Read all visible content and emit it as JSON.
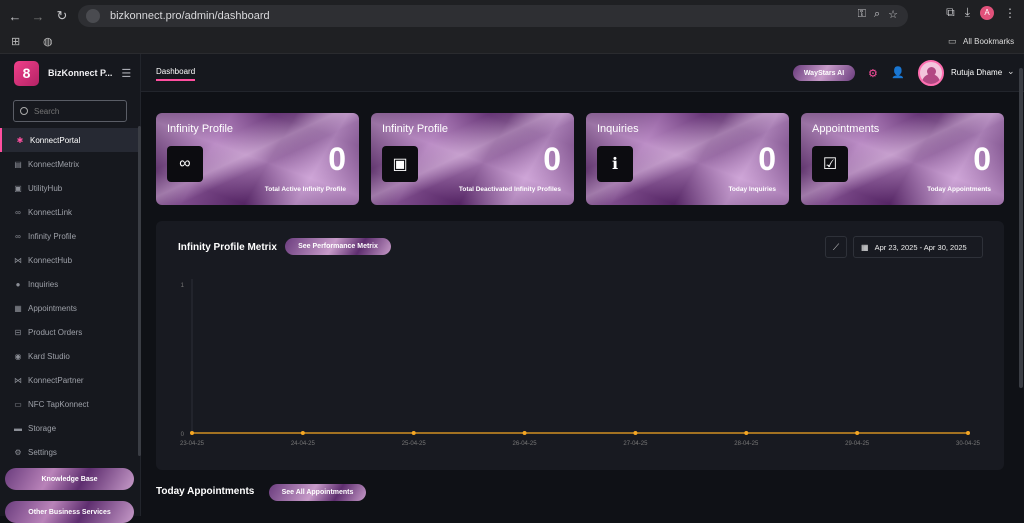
{
  "browser": {
    "url": "bizkonnect.pro/admin/dashboard",
    "bookmarks_label": "All Bookmarks",
    "profile_initial": "A"
  },
  "sidebar": {
    "brand": "BizKonnect P...",
    "search_placeholder": "Search",
    "items": [
      {
        "label": "KonnectPortal",
        "icon": "asterisk-icon",
        "glyph": "✱"
      },
      {
        "label": "KonnectMetrix",
        "icon": "bar-chart-icon",
        "glyph": "▤"
      },
      {
        "label": "UtilityHub",
        "icon": "briefcase-icon",
        "glyph": "▣"
      },
      {
        "label": "KonnectLink",
        "icon": "link-icon",
        "glyph": "∞"
      },
      {
        "label": "Infinity Profile",
        "icon": "infinity-icon",
        "glyph": "∞"
      },
      {
        "label": "KonnectHub",
        "icon": "handshake-icon",
        "glyph": "⋈"
      },
      {
        "label": "Inquiries",
        "icon": "info-icon",
        "glyph": "●"
      },
      {
        "label": "Appointments",
        "icon": "calendar-icon",
        "glyph": "▦"
      },
      {
        "label": "Product Orders",
        "icon": "cart-icon",
        "glyph": "⊟"
      },
      {
        "label": "Kard Studio",
        "icon": "eye-icon",
        "glyph": "◉"
      },
      {
        "label": "KonnectPartner",
        "icon": "partner-icon",
        "glyph": "⋈"
      },
      {
        "label": "NFC TapKonnect",
        "icon": "nfc-icon",
        "glyph": "▭"
      },
      {
        "label": "Storage",
        "icon": "storage-icon",
        "glyph": "▬"
      },
      {
        "label": "Settings",
        "icon": "gear-icon",
        "glyph": "⚙"
      }
    ],
    "knowledge_base": "Knowledge Base",
    "other_services": "Other Business Services"
  },
  "topbar": {
    "tab": "Dashboard",
    "waystars": "WayStars AI",
    "user_name": "Rutuja Dhame"
  },
  "cards": [
    {
      "title": "Infinity Profile",
      "value": "0",
      "subtitle": "Total Active Infinity Profile",
      "icon": "infinity-icon",
      "glyph": "∞"
    },
    {
      "title": "Infinity Profile",
      "value": "0",
      "subtitle": "Total Deactivated Infinity Profiles",
      "icon": "id-badge-icon",
      "glyph": "▣"
    },
    {
      "title": "Inquiries",
      "value": "0",
      "subtitle": "Today Inquiries",
      "icon": "info-icon",
      "glyph": "ℹ"
    },
    {
      "title": "Appointments",
      "value": "0",
      "subtitle": "Today Appointments",
      "icon": "calendar-check-icon",
      "glyph": "☑"
    }
  ],
  "metrix": {
    "title": "Infinity Profile Metrix",
    "button": "See Performance Metrix",
    "date_range": "Apr 23, 2025 - Apr 30, 2025"
  },
  "chart_data": {
    "type": "line",
    "x": [
      "23-04-25",
      "24-04-25",
      "25-04-25",
      "26-04-25",
      "27-04-25",
      "28-04-25",
      "29-04-25",
      "30-04-25"
    ],
    "series": [
      {
        "values": [
          0,
          0,
          0,
          0,
          0,
          0,
          0,
          0
        ]
      }
    ],
    "y_ticks": [
      "0",
      "1"
    ],
    "ylim": [
      0,
      1
    ],
    "line_color": "#f5a623",
    "grid": false
  },
  "appointments": {
    "title": "Today Appointments",
    "button": "See All Appointments"
  }
}
